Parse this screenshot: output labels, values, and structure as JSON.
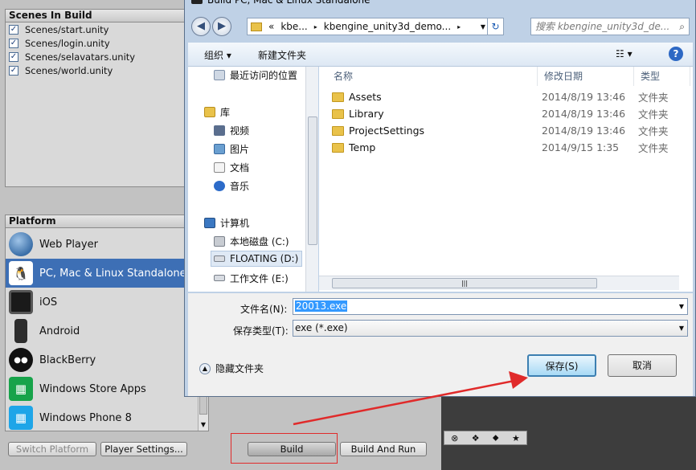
{
  "scenes": {
    "header": "Scenes In Build",
    "items": [
      {
        "name": "Scenes/start.unity",
        "checked": true
      },
      {
        "name": "Scenes/login.unity",
        "checked": true
      },
      {
        "name": "Scenes/selavatars.unity",
        "checked": true
      },
      {
        "name": "Scenes/world.unity",
        "checked": true
      }
    ]
  },
  "platform": {
    "header": "Platform",
    "items": [
      {
        "label": "Web Player",
        "icon": "globe-icon",
        "selected": false
      },
      {
        "label": "PC, Mac & Linux Standalone",
        "icon": "penguin-icon",
        "selected": true
      },
      {
        "label": "iOS",
        "icon": "ipad-icon",
        "selected": false
      },
      {
        "label": "Android",
        "icon": "android-phone-icon",
        "selected": false
      },
      {
        "label": "BlackBerry",
        "icon": "blackberry-icon",
        "selected": false
      },
      {
        "label": "Windows Store Apps",
        "icon": "windows-store-icon",
        "selected": false
      },
      {
        "label": "Windows Phone 8",
        "icon": "windows-phone-icon",
        "selected": false
      }
    ],
    "switch_label": "Switch Platform",
    "player_settings_label": "Player Settings...",
    "build_label": "Build",
    "build_and_run_label": "Build And Run"
  },
  "dialog": {
    "title": "Build PC, Mac & Linux Standalone",
    "address": {
      "chevrons": "«",
      "segment1": "kbe...",
      "segment2": "kbengine_unity3d_demo...",
      "arrow": "▸"
    },
    "search_placeholder": "搜索 kbengine_unity3d_de...",
    "toolbar": {
      "organize": "组织 ▾",
      "new_folder": "新建文件夹",
      "view": "☷ ▾",
      "help": "?"
    },
    "nav": {
      "recent": "最近访问的位置",
      "library": "库",
      "video": "视频",
      "pictures": "图片",
      "documents": "文档",
      "music": "音乐",
      "computer": "计算机",
      "local_disk": "本地磁盘 (C:)",
      "floating": "FLOATING (D:)",
      "work_files": "工作文件 (E:)"
    },
    "columns": {
      "name": "名称",
      "modified": "修改日期",
      "type": "类型"
    },
    "files": [
      {
        "name": "Assets",
        "modified": "2014/8/19 13:46",
        "type": "文件夹"
      },
      {
        "name": "Library",
        "modified": "2014/8/19 13:46",
        "type": "文件夹"
      },
      {
        "name": "ProjectSettings",
        "modified": "2014/8/19 13:46",
        "type": "文件夹"
      },
      {
        "name": "Temp",
        "modified": "2014/9/15 1:35",
        "type": "文件夹"
      }
    ],
    "filename_label": "文件名(N):",
    "filename_value": "20013.exe",
    "filetype_label": "保存类型(T):",
    "filetype_value": "exe (*.exe)",
    "hide_folders_label": "隐藏文件夹",
    "save_label": "保存(S)",
    "cancel_label": "取消"
  },
  "colors": {
    "accent_selection": "#3d6fb5",
    "annotation_red": "#e02a2a"
  }
}
